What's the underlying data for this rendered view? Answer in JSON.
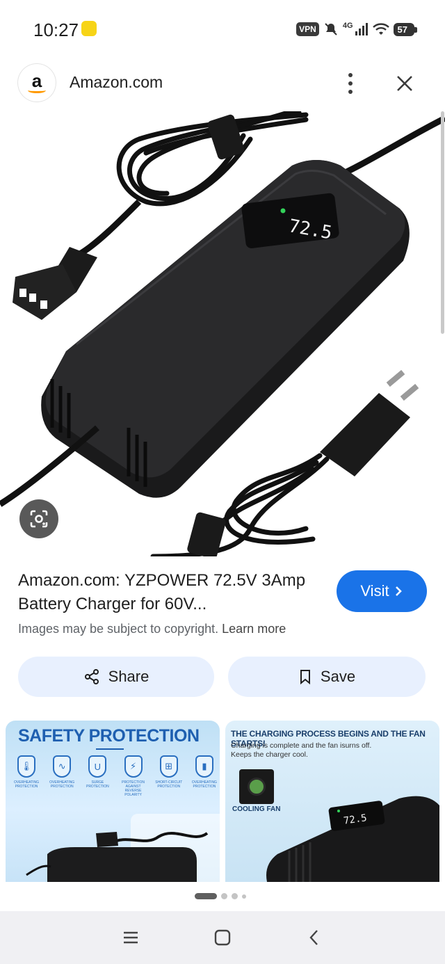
{
  "status_bar": {
    "time": "10:27",
    "vpn": "VPN",
    "network": "4G",
    "battery": "57"
  },
  "header": {
    "site_logo_letter": "a",
    "site_name": "Amazon.com"
  },
  "result": {
    "title": "Amazon.com: YZPOWER 72.5V 3Amp Battery Charger for 60V...",
    "visit_label": "Visit",
    "copyright_text": "Images may be subject to copyright.",
    "learn_more": "Learn more"
  },
  "actions": {
    "share_label": "Share",
    "save_label": "Save"
  },
  "product_display": "72.5",
  "related": {
    "card1": {
      "title": "SAFETY PROTECTION",
      "shields": [
        {
          "glyph": "🌡",
          "label": "OVERHEATING PROTECTION"
        },
        {
          "glyph": "∿",
          "label": "OVERHEATING PROTECTION"
        },
        {
          "glyph": "U",
          "label": "SURGE PROTECTION"
        },
        {
          "glyph": "⚡",
          "label": "PROTECTION AGAINST REVERSE POLARITY"
        },
        {
          "glyph": "⊞",
          "label": "SHORT-CIRCUIT PROTECTION"
        },
        {
          "glyph": "▮",
          "label": "OVERHEATING PROTECTION"
        }
      ]
    },
    "card2": {
      "title": "THE CHARGING PROCESS BEGINS AND THE FAN STARTS!",
      "sub_line1": "Charging is complete and the fan isurns off.",
      "sub_line2": "Keeps the charger cool.",
      "fan_label": "COOLING FAN",
      "display": "72.5"
    }
  },
  "colors": {
    "accent": "#1a73e8",
    "tonal_button": "#e8f0fe",
    "amazon_orange": "#ff9900"
  }
}
